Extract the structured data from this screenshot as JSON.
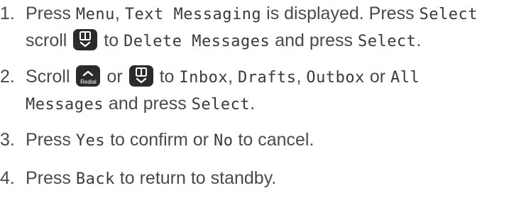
{
  "steps": [
    {
      "number": "1.",
      "press": "Press",
      "menu": "Menu",
      "comma": ",",
      "text_messaging": "Text Messaging",
      "is_displayed": "is displayed. Press",
      "select": "Select",
      "scroll": "scroll",
      "to": "to",
      "delete_messages": "Delete Messages",
      "and_press": "and press",
      "select2": "Select",
      "period": "."
    },
    {
      "number": "2.",
      "scroll": "Scroll",
      "redial_key_label": "Redial",
      "or": "or",
      "to": "to",
      "inbox": "Inbox",
      "comma1": ",",
      "drafts": "Drafts",
      "comma2": ",",
      "outbox": "Outbox",
      "or2": "or",
      "all": "All",
      "messages": "Messages",
      "and_press": "and press",
      "select": "Select",
      "period": "."
    },
    {
      "number": "3.",
      "press": "Press",
      "yes": "Yes",
      "to_confirm_or": "to confirm or",
      "no": "No",
      "to_cancel": "to cancel."
    },
    {
      "number": "4.",
      "press": "Press",
      "back": "Back",
      "to_return": "to return to standby."
    }
  ],
  "icons": {
    "scroll_down_key": "phonebook-down-key-icon",
    "scroll_up_key": "redial-up-key-icon"
  }
}
